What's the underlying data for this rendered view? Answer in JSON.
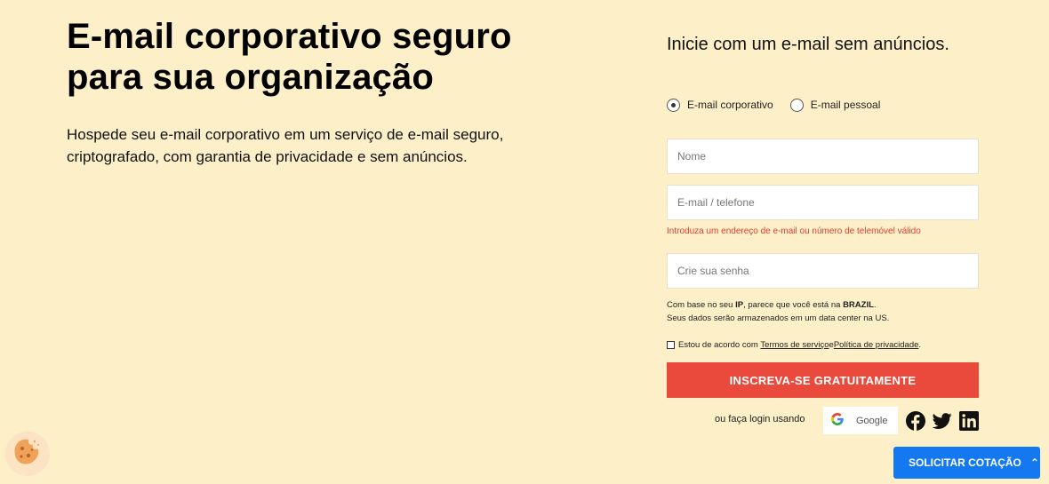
{
  "hero": {
    "title": "E-mail corporativo seguro para sua organização",
    "subtitle": "Hospede seu e-mail corporativo em um serviço de e-mail seguro, criptografado, com garantia de privacidade e sem anúncios."
  },
  "form": {
    "title": "Inicie com um e-mail sem anúncios.",
    "radio_business": "E-mail corporativo",
    "radio_personal": "E-mail pessoal",
    "name_placeholder": "Nome",
    "email_placeholder": "E-mail / telefone",
    "error_text": "Introduza um endereço de e-mail ou número de telemóvel válido",
    "password_placeholder": "Crie sua senha",
    "ip_note_prefix": "Com base no seu ",
    "ip_note_ip": "IP",
    "ip_note_mid": ", parece que você está na ",
    "ip_note_country": "BRAZIL",
    "ip_note_suffix": ".",
    "ip_note_line2": "Seus dados serão armazenados em um data center na US.",
    "terms_prefix": "Estou de acordo com ",
    "terms_link": "Termos de serviço",
    "terms_and": " e ",
    "privacy_link": "Política de privacidade",
    "terms_suffix": ".",
    "submit_label": "INSCREVA-SE GRATUITAMENTE",
    "or_login": "ou faça login usando",
    "google_label": "Google",
    "google_letter": "G"
  },
  "quote_button": {
    "label": "SOLICITAR COTAÇÃO",
    "chevron": "⌃"
  },
  "colors": {
    "background": "#fdefc7",
    "submit": "#ea4a3b",
    "error": "#e63c2f",
    "quote": "#1478f1"
  },
  "icons": [
    "radio-checked-icon",
    "radio-unchecked-icon",
    "google-icon",
    "facebook-icon",
    "twitter-icon",
    "linkedin-icon",
    "cookie-icon",
    "chevron-up-icon"
  ]
}
